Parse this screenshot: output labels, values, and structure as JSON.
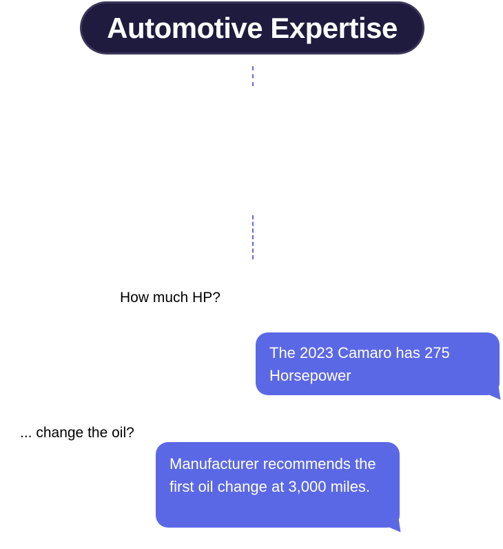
{
  "title": "Automotive Expertise",
  "colors": {
    "title_background": "#1f1b3f",
    "accent": "#5b68e6",
    "bubble_text": "#ffffff"
  },
  "conversation": [
    {
      "question": "How much HP?",
      "answer": "The 2023 Camaro has 275 Horsepower"
    },
    {
      "question": "... change the oil?",
      "answer": "Manufacturer recommends the first oil change at 3,000 miles."
    }
  ]
}
